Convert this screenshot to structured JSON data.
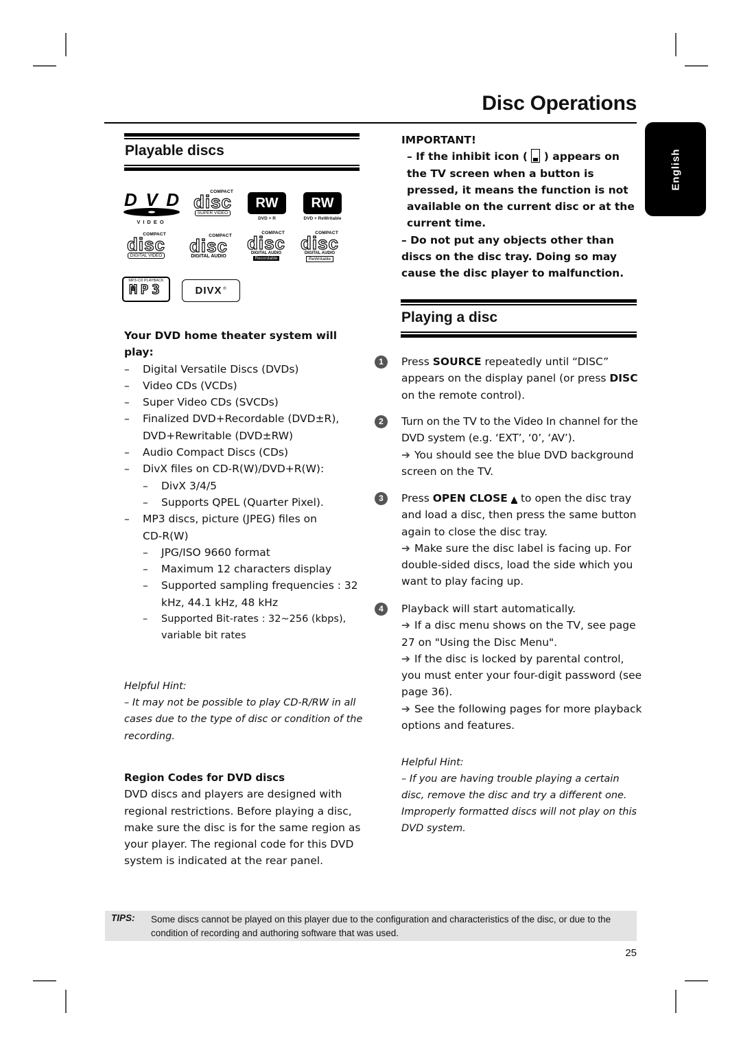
{
  "page": {
    "title": "Disc Operations",
    "language_tab": "English",
    "page_number": "25"
  },
  "playable_discs": {
    "heading": "Playable discs",
    "logos": [
      {
        "name": "dvd-video",
        "main": "DVD",
        "sub": "VIDEO"
      },
      {
        "name": "compact-disc-super-video",
        "top": "COMPACT",
        "main": "disc",
        "sub": "SUPER  VIDEO"
      },
      {
        "name": "dvd-plus-r",
        "main": "RW",
        "sub": "DVD + R"
      },
      {
        "name": "dvd-plus-rewritable",
        "main": "RW",
        "sub": "DVD + ReWritable"
      },
      {
        "name": "compact-disc-digital-video",
        "top": "COMPACT",
        "main": "disc",
        "sub": "DIGITAL VIDEO"
      },
      {
        "name": "compact-disc-digital-audio",
        "top": "COMPACT",
        "main": "disc",
        "sub": "DIGITAL AUDIO"
      },
      {
        "name": "compact-disc-recordable",
        "top": "COMPACT",
        "main": "disc",
        "sub": "DIGITAL AUDIO",
        "sub2": "Recordable"
      },
      {
        "name": "compact-disc-rewritable",
        "top": "COMPACT",
        "main": "disc",
        "sub": "DIGITAL AUDIO",
        "sub2": "ReWritable"
      },
      {
        "name": "mp3-cd-playback",
        "top": "MP3-CD PLAYBACK",
        "main": "MP3"
      },
      {
        "name": "divx",
        "main": "DIVX",
        "mark": "®"
      }
    ],
    "plays_heading": "Your DVD home theater system will play:",
    "plays": [
      {
        "text": "Digital Versatile Discs (DVDs)"
      },
      {
        "text": "Video CDs (VCDs)"
      },
      {
        "text": "Super Video CDs (SVCDs)"
      },
      {
        "text": "Finalized DVD+Recordable (DVD±R), DVD+Rewritable (DVD±RW)"
      },
      {
        "text": "Audio Compact Discs (CDs)"
      },
      {
        "text": "DivX files on CD-R(W)/DVD+R(W):",
        "sub": [
          "DivX 3/4/5",
          "Supports QPEL (Quarter Pixel)."
        ]
      },
      {
        "text": "MP3 discs, picture (JPEG) files on CD-R(W)",
        "sub": [
          "JPG/ISO 9660 format",
          "Maximum 12 characters display",
          "Supported sampling frequencies : 32 kHz, 44.1 kHz, 48 kHz",
          "Supported Bit-rates : 32~256 (kbps), variable bit rates"
        ]
      }
    ],
    "hint_label": "Helpful Hint:",
    "hint_text": "– It may not be possible to play CD-R/RW in all cases due to the type of disc or condition of the recording.",
    "region_heading": "Region Codes for DVD discs",
    "region_text": "DVD discs and players are designed with regional restrictions. Before playing a disc, make sure the disc is for the same region as your player.  The regional code for this DVD system is indicated at the rear panel."
  },
  "important": {
    "heading": "IMPORTANT!",
    "line1_a": "– If the inhibit icon (",
    "line1_b": ") appears on the TV screen when a button is pressed, it means the function is not available on the current disc or at the current time.",
    "line2": "– Do not put any objects other than discs on the disc tray.  Doing so may cause the disc player to malfunction.",
    "icon": "inhibit-hand-icon"
  },
  "playing_disc": {
    "heading": "Playing a disc",
    "steps": [
      {
        "num": "1",
        "a": "Press ",
        "b": "SOURCE",
        "c": " repeatedly until “DISC” appears on the display panel (or press ",
        "d": "DISC",
        "e": " on the remote control)."
      },
      {
        "num": "2",
        "a": "Turn on the TV to the Video In channel for the DVD system (e.g. ‘EXT’, ‘0’, ‘AV’).",
        "notes": [
          "You should see the blue DVD background screen on the TV."
        ]
      },
      {
        "num": "3",
        "a": "Press ",
        "b": "OPEN CLOSE",
        "eject": "▲",
        "c": " to open the disc tray and load a disc, then press the same button again to close the disc tray.",
        "notes": [
          "Make sure the disc label is facing up. For double-sided discs, load the side which you want to play facing up."
        ]
      },
      {
        "num": "4",
        "a": "Playback will start automatically.",
        "notes": [
          "If a disc menu shows on the TV, see page 27 on \"Using the Disc Menu\".",
          "If the disc is locked by parental control, you must enter your four-digit password (see page 36).",
          "See the following pages for more playback options and features."
        ]
      }
    ],
    "arrow": "➔",
    "hint_label": "Helpful Hint:",
    "hint_text": "– If you are having trouble playing a certain disc, remove the disc and try a different one. Improperly formatted discs will not play on this DVD system."
  },
  "tips": {
    "label": "TIPS:",
    "text": "Some discs cannot be played on this player due to the configuration and characteristics of the disc, or due to the condition of recording and authoring software that was used."
  }
}
